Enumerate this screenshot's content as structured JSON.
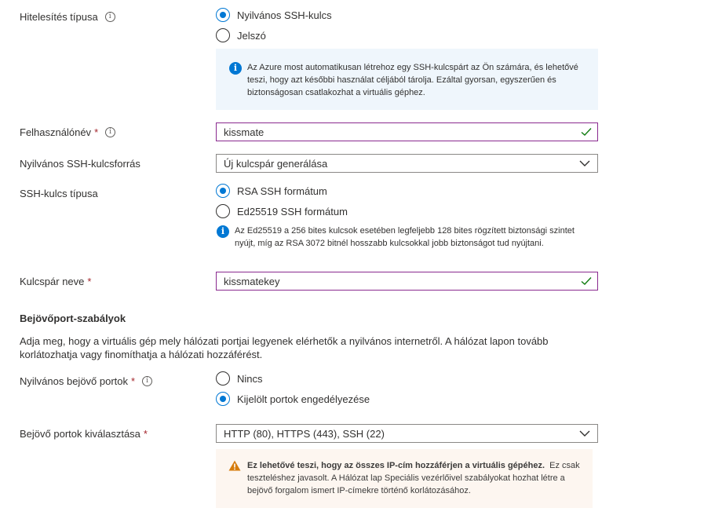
{
  "auth": {
    "label": "Hitelesítés típusa",
    "options": [
      "Nyilvános SSH-kulcs",
      "Jelszó"
    ],
    "selected": 0,
    "info": "Az Azure most automatikusan létrehoz egy SSH-kulcspárt az Ön számára, és lehetővé teszi, hogy azt későbbi használat céljából tárolja. Ezáltal gyorsan, egyszerűen és biztonságosan csatlakozhat a virtuális géphez."
  },
  "username": {
    "label": "Felhasználónév",
    "value": "kissmate"
  },
  "key_source": {
    "label": "Nyilvános SSH-kulcsforrás",
    "value": "Új kulcspár generálása"
  },
  "key_type": {
    "label": "SSH-kulcs típusa",
    "options": [
      "RSA SSH formátum",
      "Ed25519 SSH formátum"
    ],
    "selected": 0,
    "info": "Az Ed25519 a 256 bites kulcsok esetében legfeljebb 128 bites rögzített biztonsági szintet nyújt, míg az RSA 3072 bitnél hosszabb kulcsokkal jobb biztonságot tud nyújtani."
  },
  "key_name": {
    "label": "Kulcspár neve",
    "value": "kissmatekey"
  },
  "inbound": {
    "heading": "Bejövőport-szabályok",
    "description": "Adja meg, hogy a virtuális gép mely hálózati portjai legyenek elérhetők a nyilvános internetről. A hálózat lapon tovább korlátozhatja vagy finomíthatja a hálózati hozzáférést.",
    "public_ports_label": "Nyilvános bejövő portok",
    "public_ports_options": [
      "Nincs",
      "Kijelölt portok engedélyezése"
    ],
    "public_ports_selected": 1,
    "select_label": "Bejövő portok kiválasztása",
    "select_value": "HTTP (80), HTTPS (443), SSH (22)",
    "warning_bold": "Ez lehetővé teszi, hogy az összes IP-cím hozzáférjen a virtuális gépéhez.",
    "warning_rest": "Ez csak teszteléshez javasolt.  A Hálózat lap Speciális vezérlőivel szabályokat hozhat létre a bejövő forgalom ismert IP-címekre történő korlátozásához."
  },
  "required_mark": "*",
  "colors": {
    "accent": "#0078d4",
    "focus_border": "#8a2a8f",
    "valid": "#107c10",
    "warning": "#d47500",
    "required": "#a4262c"
  }
}
